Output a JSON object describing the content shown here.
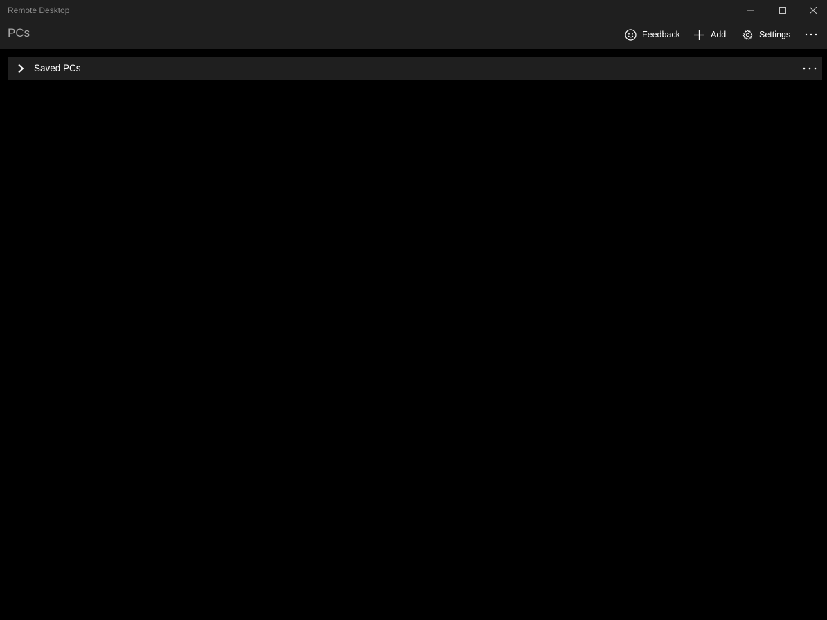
{
  "window": {
    "app_title": "Remote Desktop"
  },
  "caption_buttons": {
    "minimize_icon": "minimize-icon",
    "maximize_icon": "maximize-icon",
    "close_icon": "close-icon"
  },
  "header": {
    "page_title": "PCs",
    "commands": {
      "feedback": {
        "label": "Feedback",
        "icon": "smiley-icon"
      },
      "add": {
        "label": "Add",
        "icon": "plus-icon"
      },
      "settings": {
        "label": "Settings",
        "icon": "gear-icon"
      },
      "more": {
        "icon": "more-icon"
      }
    }
  },
  "groups": [
    {
      "label": "Saved PCs",
      "expanded": false,
      "icon": "chevron-right-icon",
      "more_icon": "more-icon"
    }
  ],
  "colors": {
    "background": "#000000",
    "chrome": "#1f1f1f",
    "title_text": "#8a8a8a",
    "page_title_text": "#a8a8a8",
    "text": "#ffffff"
  }
}
